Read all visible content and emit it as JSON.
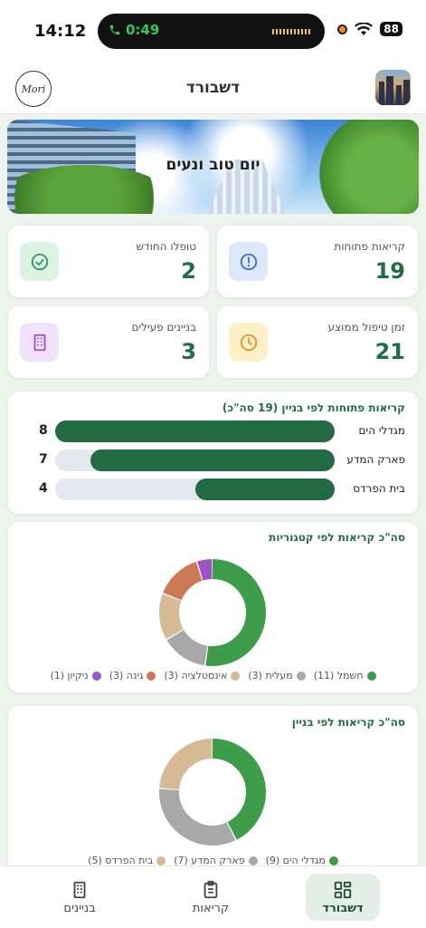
{
  "status_bar": {
    "time": "14:12",
    "call_timer": "0:49",
    "battery": "88"
  },
  "header": {
    "title": "דשבורד",
    "logo_text": "Mori"
  },
  "hero": {
    "greeting": "יום טוב ונעים"
  },
  "stats": {
    "open_calls": {
      "label": "קריאות פתוחות",
      "value": "19",
      "color": "#3b6fd6"
    },
    "handled_month": {
      "label": "טופלו החודש",
      "value": "2",
      "color": "#2e9d5c"
    },
    "avg_time": {
      "label": "זמן טיפול ממוצע",
      "value": "21",
      "color": "#e39a1b"
    },
    "active_buildings": {
      "label": "בניינים פעילים",
      "value": "3",
      "color": "#9a4fd0"
    }
  },
  "open_by_building": {
    "title": "קריאות פתוחות לפי בניין (19 סה\"כ)",
    "rows": [
      {
        "name": "מגדלי הים",
        "value": "8"
      },
      {
        "name": "פארק המדע",
        "value": "7"
      },
      {
        "name": "בית הפרדס",
        "value": "4"
      }
    ]
  },
  "by_category": {
    "title": "סה\"כ קריאות לפי קטגוריות",
    "legend": [
      "חשמל (11)",
      "מעלית (3)",
      "אינסטלציה (3)",
      "גינה (3)",
      "ניקיון (1)"
    ]
  },
  "by_building": {
    "title": "סה\"כ קריאות לפי בניין",
    "legend": [
      "מגדלי הים (9)",
      "פארק המדע (7)",
      "בית הפרדס (5)"
    ]
  },
  "chart_data": [
    {
      "type": "bar",
      "title": "קריאות פתוחות לפי בניין (19 סה\"כ)",
      "categories": [
        "מגדלי הים",
        "פארק המדע",
        "בית הפרדס"
      ],
      "values": [
        8,
        7,
        4
      ],
      "color": "#236b45"
    },
    {
      "type": "pie",
      "title": "סה\"כ קריאות לפי קטגוריות",
      "categories": [
        "חשמל",
        "מעלית",
        "אינסטלציה",
        "גינה",
        "ניקיון"
      ],
      "values": [
        11,
        3,
        3,
        3,
        1
      ],
      "colors": [
        "#3e9d4a",
        "#a8a8a8",
        "#d6b995",
        "#cc7a55",
        "#9b55c2"
      ]
    },
    {
      "type": "pie",
      "title": "סה\"כ קריאות לפי בניין",
      "categories": [
        "מגדלי הים",
        "פארק המדע",
        "בית הפרדס"
      ],
      "values": [
        9,
        7,
        5
      ],
      "colors": [
        "#3e9d4a",
        "#a8a8a8",
        "#d6b995"
      ]
    }
  ],
  "tabs": {
    "dashboard": "דשבורד",
    "calls": "קריאות",
    "buildings": "בניינים"
  }
}
